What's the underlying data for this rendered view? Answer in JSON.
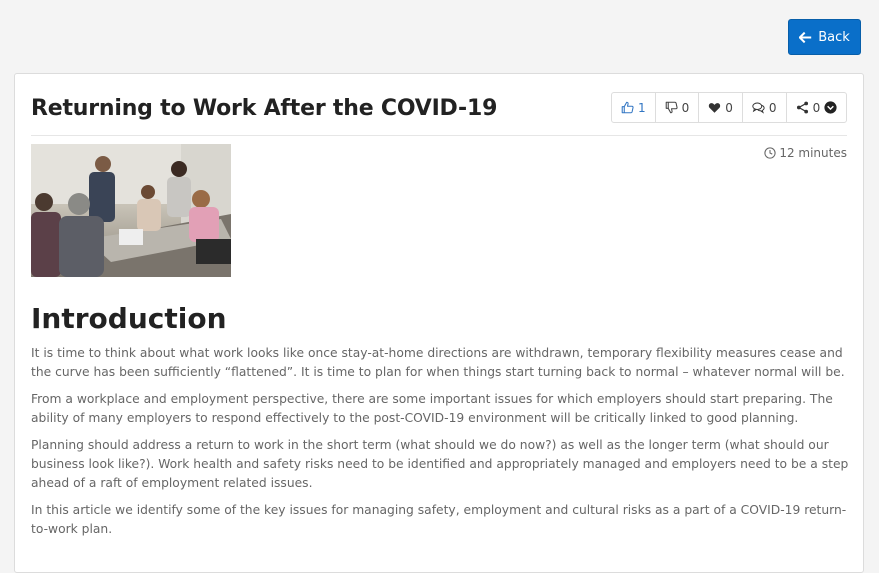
{
  "header": {
    "back_label": "Back"
  },
  "article": {
    "title": "Returning to Work After the COVID-19",
    "actions": [
      {
        "name": "like",
        "icon": "thumbs-up-icon",
        "count": "1"
      },
      {
        "name": "dislike",
        "icon": "thumbs-down-icon",
        "count": "0"
      },
      {
        "name": "favorite",
        "icon": "heart-icon",
        "count": "0"
      },
      {
        "name": "comments",
        "icon": "comments-icon",
        "count": "0"
      },
      {
        "name": "share",
        "icon": "share-icon",
        "count": "0"
      }
    ],
    "read_time": "12 minutes",
    "section_heading": "Introduction",
    "paragraphs": [
      "It is time to think about what work looks like once stay-at-home directions are withdrawn, temporary flexibility measures cease and the curve has been sufficiently “flattened”. It is time to plan for when things start turning back to normal – whatever normal will be.",
      "From a workplace and employment perspective, there are some important issues for which employers should start preparing. The ability of many employers to respond effectively to the post-COVID-19 environment will be critically linked to good planning.",
      "Planning should address a return to work in the short term (what should we do now?) as well as the longer term (what should our business look like?). Work health and safety risks need to be identified and appropriately managed and employers need to be a step ahead of a raft of employment related issues.",
      "In this article we identify some of the key issues for managing safety, employment and cultural risks as a part of a COVID-19 return-to-work plan."
    ]
  },
  "colors": {
    "accent": "#0a6fc9",
    "like": "#3276c3"
  }
}
